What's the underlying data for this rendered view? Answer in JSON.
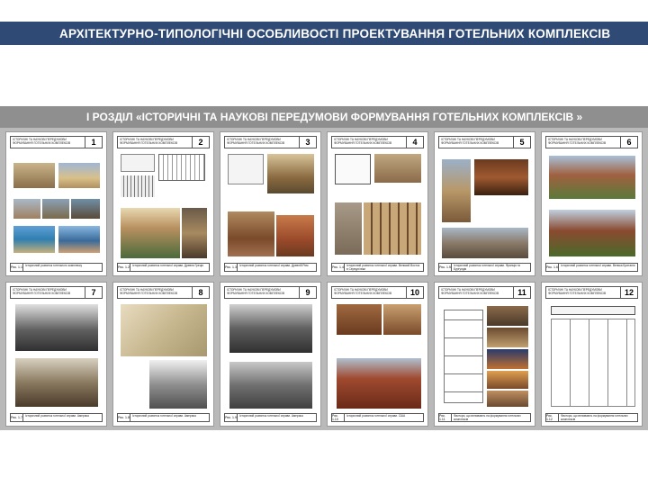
{
  "title": "АРХІТЕКТУРНО-ТИПОЛОГІЧНІ ОСОБЛИВОСТІ  ПРОЕКТУВАННЯ ГОТЕЛЬНИХ КОМПЛЕКСІВ",
  "section": "І РОЗДІЛ «ІСТОРИЧНІ ТА НАУКОВІ ПЕРЕДУМОВИ ФОРМУВАННЯ ГОТЕЛЬНИХ КОМПЛЕКСІВ »",
  "sheets": [
    {
      "number": "1",
      "header": "ІСТОРИЧНІ ТА НАУКОВІ ПЕРЕДУМОВИ ФОРМУВАННЯ ГОТЕЛЬНИХ КОМПЛЕКСІВ",
      "ref": "Рис. 1.1",
      "caption": "Історичний розвиток готельного комплексу"
    },
    {
      "number": "2",
      "header": "ІСТОРИЧНІ ТА НАУКОВІ ПЕРЕДУМОВИ ФОРМУВАННЯ ГОТЕЛЬНИХ КОМПЛЕКСІВ",
      "ref": "Рис. 1.2",
      "caption": "Історичний розвиток готельної справи. Древня Греція"
    },
    {
      "number": "3",
      "header": "ІСТОРИЧНІ ТА НАУКОВІ ПЕРЕДУМОВИ ФОРМУВАННЯ ГОТЕЛЬНИХ КОМПЛЕКСІВ",
      "ref": "Рис. 1.3",
      "caption": "Історичний розвиток готельної справи. Древній Рим"
    },
    {
      "number": "4",
      "header": "ІСТОРИЧНІ ТА НАУКОВІ ПЕРЕДУМОВИ ФОРМУВАННЯ ГОТЕЛЬНИХ КОМПЛЕКСІВ",
      "ref": "Рис. 1.4",
      "caption": "Історичний розвиток готельної справи. Великий Восток в Середні віки"
    },
    {
      "number": "5",
      "header": "ІСТОРИЧНІ ТА НАУКОВІ ПЕРЕДУМОВИ ФОРМУВАННЯ ГОТЕЛЬНИХ КОМПЛЕКСІВ",
      "ref": "Рис. 1.5",
      "caption": "Історичний розвиток готельної справи. Франція та Бургундія"
    },
    {
      "number": "6",
      "header": "ІСТОРИЧНІ ТА НАУКОВІ ПЕРЕДУМОВИ ФОРМУВАННЯ ГОТЕЛЬНИХ КОМПЛЕКСІВ",
      "ref": "Рис. 1.6",
      "caption": "Історичний розвиток готельної справи. Велика Британія"
    },
    {
      "number": "7",
      "header": "ІСТОРИЧНІ ТА НАУКОВІ ПЕРЕДУМОВИ ФОРМУВАННЯ ГОТЕЛЬНИХ КОМПЛЕКСІВ",
      "ref": "Рис. 1.7",
      "caption": "Історичний розвиток готельної справи. Америка"
    },
    {
      "number": "8",
      "header": "ІСТОРИЧНІ ТА НАУКОВІ ПЕРЕДУМОВИ ФОРМУВАННЯ ГОТЕЛЬНИХ КОМПЛЕКСІВ",
      "ref": "Рис. 1.8",
      "caption": "Історичний розвиток готельної справи. Америка"
    },
    {
      "number": "9",
      "header": "ІСТОРИЧНІ ТА НАУКОВІ ПЕРЕДУМОВИ ФОРМУВАННЯ ГОТЕЛЬНИХ КОМПЛЕКСІВ",
      "ref": "Рис. 1.9",
      "caption": "Історичний розвиток готельної справи. Америка"
    },
    {
      "number": "10",
      "header": "ІСТОРИЧНІ ТА НАУКОВІ ПЕРЕДУМОВИ ФОРМУВАННЯ ГОТЕЛЬНИХ КОМПЛЕКСІВ",
      "ref": "Рис. 1.10",
      "caption": "Історичний розвиток готельної справи. США"
    },
    {
      "number": "11",
      "header": "ІСТОРИЧНІ ТА НАУКОВІ ПЕРЕДУМОВИ ФОРМУВАННЯ ГОТЕЛЬНИХ КОМПЛЕКСІВ",
      "ref": "Рис. 1.11",
      "caption": "Фактори, що впливають на формування готельних комплексів"
    },
    {
      "number": "12",
      "header": "ІСТОРИЧНІ ТА НАУКОВІ ПЕРЕДУМОВИ ФОРМУВАННЯ ГОТЕЛЬНИХ КОМПЛЕКСІВ",
      "ref": "Рис. 1.12",
      "caption": "Фактори, що впливають на формування готельних комплексів"
    }
  ]
}
